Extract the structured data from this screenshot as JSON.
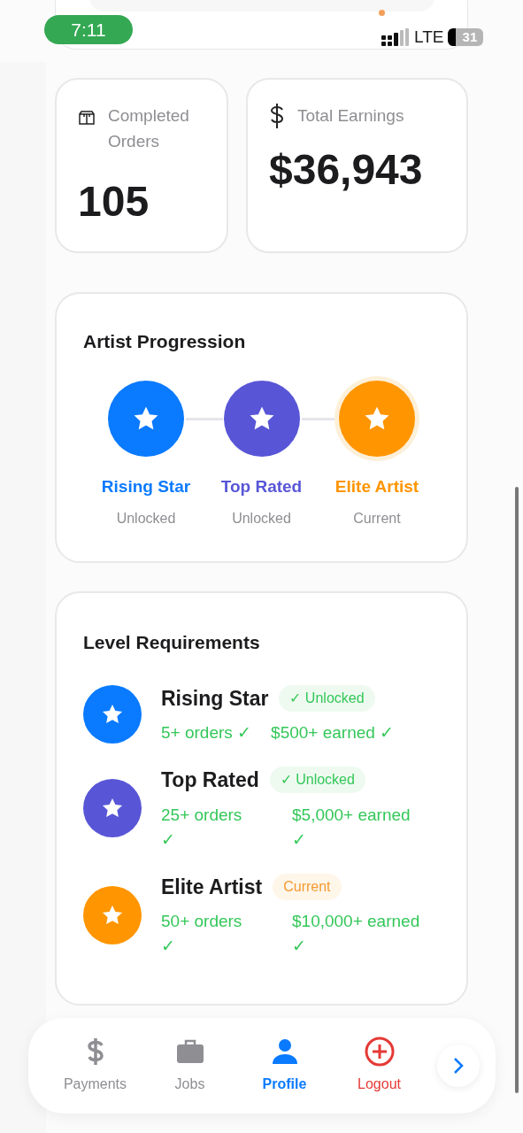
{
  "status_bar": {
    "time": "7:11",
    "network": "LTE",
    "battery": "31"
  },
  "stats": [
    {
      "kind": "orders",
      "label": "Completed Orders",
      "value": "105"
    },
    {
      "kind": "earnings",
      "label": "Total Earnings",
      "value": "$36,943"
    }
  ],
  "progression": {
    "title": "Artist Progression",
    "levels": [
      {
        "name": "Rising Star",
        "status": "Unlocked",
        "color": "#0a7aff",
        "selected": false
      },
      {
        "name": "Top Rated",
        "status": "Unlocked",
        "color": "#5856d6",
        "selected": false
      },
      {
        "name": "Elite Artist",
        "status": "Current",
        "color": "#ff9500",
        "selected": true
      }
    ]
  },
  "requirements": {
    "title": "Level Requirements",
    "items": [
      {
        "name": "Rising Star",
        "color": "#0a7aff",
        "badge": {
          "kind": "unlocked",
          "text": "✓ Unlocked"
        },
        "checks_inline": true,
        "criteria": [
          {
            "label": "5+ orders",
            "check": "✓"
          },
          {
            "label": "$500+ earned",
            "check": "✓"
          }
        ]
      },
      {
        "name": "Top Rated",
        "color": "#5856d6",
        "badge": {
          "kind": "unlocked",
          "text": "✓ Unlocked"
        },
        "checks_inline": false,
        "criteria": [
          {
            "label": "25+ orders",
            "check": "✓"
          },
          {
            "label": "$5,000+ earned",
            "check": "✓"
          }
        ]
      },
      {
        "name": "Elite Artist",
        "color": "#ff9500",
        "badge": {
          "kind": "current",
          "text": "Current"
        },
        "checks_inline": false,
        "criteria": [
          {
            "label": "50+ orders",
            "check": "✓"
          },
          {
            "label": "$10,000+ earned",
            "check": "✓"
          }
        ]
      }
    ]
  },
  "tab_bar": {
    "tabs": [
      {
        "kind": "payments",
        "label": "Payments",
        "selected": false
      },
      {
        "kind": "jobs",
        "label": "Jobs",
        "selected": false
      },
      {
        "kind": "profile",
        "label": "Profile",
        "selected": true
      },
      {
        "kind": "logout",
        "label": "Logout",
        "selected": false
      }
    ]
  }
}
